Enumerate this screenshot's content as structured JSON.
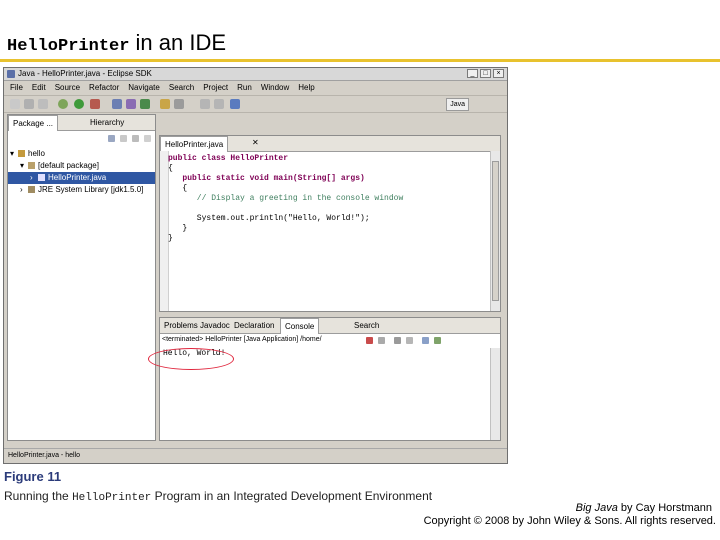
{
  "slide": {
    "title_code": "HelloPrinter",
    "title_rest": " in an IDE"
  },
  "window": {
    "title": "Java - HelloPrinter.java - Eclipse SDK",
    "menu": [
      "File",
      "Edit",
      "Source",
      "Refactor",
      "Navigate",
      "Search",
      "Project",
      "Run",
      "Window",
      "Help"
    ],
    "perspective": "Java",
    "buttons": {
      "minimize": "_",
      "maximize": "□",
      "close": "×"
    }
  },
  "explorer": {
    "tabs": [
      "Package ...",
      "Hierarchy"
    ],
    "rows": [
      "hello",
      "[default package]",
      "HelloPrinter.java",
      "JRE System Library [jdk1.5.0]"
    ]
  },
  "editor": {
    "tab": "HelloPrinter.java",
    "lines": [
      "public class HelloPrinter",
      "{",
      "   public static void main(String[] args)",
      "   {",
      "      // Display a greeting in the console window",
      "",
      "      System.out.println(\"Hello, World!\");",
      "   }",
      "}"
    ]
  },
  "console": {
    "tabs": [
      "Problems",
      "Javadoc",
      "Declaration",
      "Console",
      "Search"
    ],
    "header": "<terminated> HelloPrinter [Java Application] /home/",
    "output": "Hello, World!"
  },
  "status": {
    "text": "HelloPrinter.java - hello"
  },
  "caption": {
    "figure_label": "Figure 11",
    "text_before": "Running the ",
    "text_code": "HelloPrinter",
    "text_after": " Program in an Integrated Development Environment"
  },
  "credit": {
    "book": "Big Java",
    "by": " by Cay Horstmann",
    "copyright": "Copyright © 2008 by John Wiley & Sons.  All rights reserved."
  },
  "colors": {
    "accent_rule": "#e8c22e",
    "selection": "#2f57a3",
    "oval": "#e0263d"
  }
}
